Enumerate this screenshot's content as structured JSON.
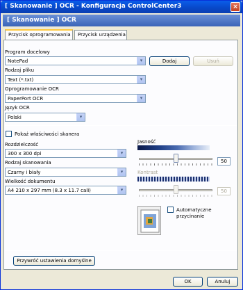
{
  "window": {
    "title": "[ Skanowanie ] OCR - Konfiguracja ControlCenter3",
    "close_glyph": "×"
  },
  "header": {
    "text": "[ Skanowanie ] OCR"
  },
  "tabs": [
    {
      "label": "Przycisk oprogramowania",
      "active": true
    },
    {
      "label": "Przycisk urządzenia",
      "active": false
    }
  ],
  "form": {
    "target_app_label": "Program docelowy",
    "target_app_value": "NotePad",
    "add_button": "Dodaj",
    "remove_button": "Usuń",
    "file_type_label": "Rodzaj pliku",
    "file_type_value": "Text (*.txt)",
    "ocr_software_label": "Oprogramowanie OCR",
    "ocr_software_value": "PaperPort OCR",
    "ocr_language_label": "Język OCR",
    "ocr_language_value": "Polski",
    "show_scanner_props_label": "Pokaż właściwości skanera",
    "resolution_label": "Rozdzielczość",
    "resolution_value": "300 x 300 dpi",
    "scan_type_label": "Rodzaj skanowania",
    "scan_type_value": "Czarny i biały",
    "document_size_label": "Wielkość dokumentu",
    "document_size_value": "A4 210 x 297 mm (8.3 x 11.7 cali)",
    "brightness_label": "Jasność",
    "brightness_value": "50",
    "brightness_level": 0.5,
    "contrast_label": "Kontrast",
    "contrast_value": "50",
    "contrast_level": 0.5,
    "auto_crop_label_1": "Automatyczne",
    "auto_crop_label_2": "przycinanie",
    "restore_defaults_button": "Przywróć ustawienia domyślne"
  },
  "footer": {
    "ok_button": "OK",
    "cancel_button": "Anuluj"
  },
  "icons": {
    "dropdown": "chevron-down-icon",
    "close": "close-icon",
    "preview": "document-preview-icon"
  }
}
